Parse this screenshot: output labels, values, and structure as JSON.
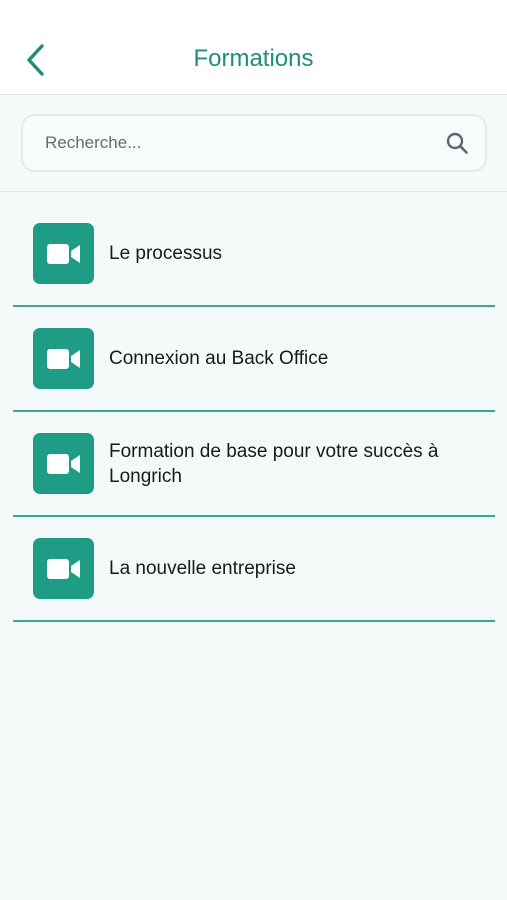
{
  "header": {
    "back_icon": "chevron-left-icon",
    "title": "Formations"
  },
  "search": {
    "placeholder": "Recherche...",
    "icon": "search-icon"
  },
  "colors": {
    "accent": "#1f9c86",
    "title": "#1f8d7c",
    "divider": "#3aa697",
    "background": "#f3faf9"
  },
  "formations": [
    {
      "label": "Le processus",
      "icon": "video-camera-icon"
    },
    {
      "label": "Connexion au Back Office",
      "icon": "video-camera-icon"
    },
    {
      "label": "Formation de base pour votre succès à Longrich",
      "icon": "video-camera-icon"
    },
    {
      "label": "La nouvelle entreprise",
      "icon": "video-camera-icon"
    }
  ]
}
